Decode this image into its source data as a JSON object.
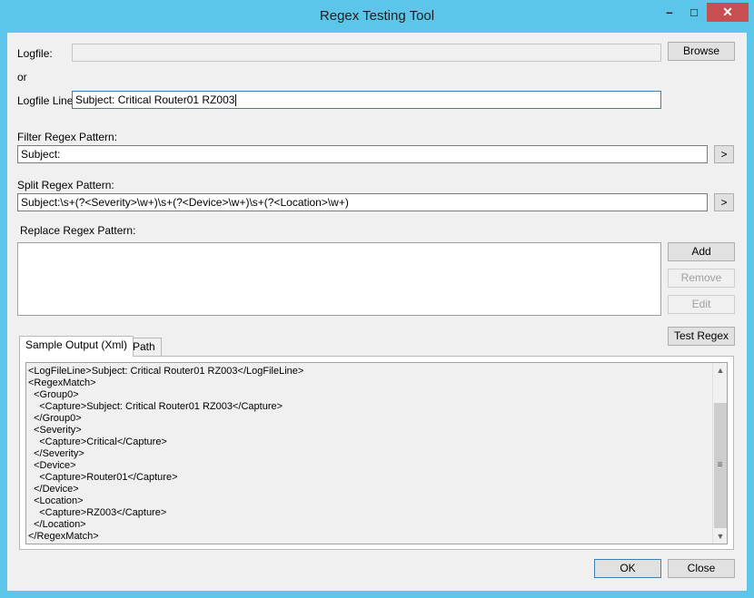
{
  "window": {
    "title": "Regex Testing Tool",
    "minimize_glyph": "–",
    "maximize_glyph": "□",
    "close_glyph": "✕"
  },
  "logfile": {
    "label": "Logfile:",
    "value": "",
    "browse_label": "Browse"
  },
  "or_label": "or",
  "logfile_line": {
    "label": "Logfile Line:",
    "value": "Subject: Critical Router01 RZ003"
  },
  "filter": {
    "label": "Filter Regex Pattern:",
    "value": "Subject:",
    "run_label": ">"
  },
  "split": {
    "label": "Split Regex Pattern:",
    "value": "Subject:\\s+(?<Severity>\\w+)\\s+(?<Device>\\w+)\\s+(?<Location>\\w+)",
    "run_label": ">"
  },
  "replace": {
    "label": "Replace Regex Pattern:",
    "add_label": "Add",
    "remove_label": "Remove",
    "edit_label": "Edit"
  },
  "test_regex_label": "Test Regex",
  "tabs": [
    {
      "label": "Sample Output (Xml)"
    },
    {
      "label": "XPath"
    }
  ],
  "output_lines": [
    "<LogFileLine>Subject: Critical Router01 RZ003</LogFileLine>",
    "<RegexMatch>",
    "  <Group0>",
    "    <Capture>Subject: Critical Router01 RZ003</Capture>",
    "  </Group0>",
    "  <Severity>",
    "    <Capture>Critical</Capture>",
    "  </Severity>",
    "  <Device>",
    "    <Capture>Router01</Capture>",
    "  </Device>",
    "  <Location>",
    "    <Capture>RZ003</Capture>",
    "  </Location>",
    "</RegexMatch>"
  ],
  "scroll": {
    "up_glyph": "▲",
    "down_glyph": "▼",
    "grip_glyph": "≡"
  },
  "ok_label": "OK",
  "close_label": "Close"
}
